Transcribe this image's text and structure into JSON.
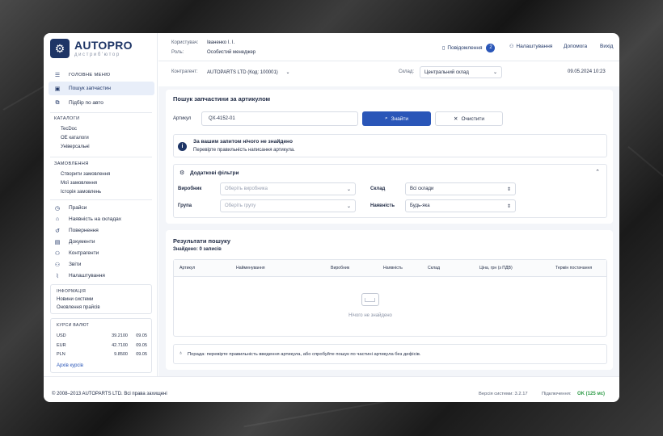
{
  "brand": {
    "name": "AUTOPRO",
    "tagline": "дистриб'ютор",
    "logo_icon": "gear-icon"
  },
  "sidebar": {
    "main_menu_label": "ГОЛОВНЕ МЕНЮ",
    "nav": [
      {
        "label": "Пошук запчастин",
        "icon": "toolbox-icon"
      },
      {
        "label": "Підбір по авто",
        "icon": "car-icon"
      }
    ],
    "catalogs_title": "КАТАЛОГИ",
    "catalogs": [
      "TecDoc",
      "OE каталоги",
      "Універсальні"
    ],
    "orders_title": "ЗАМОВЛЕННЯ",
    "orders": [
      "Створити замовлення",
      "Мої замовлення",
      "Історія замовлень"
    ],
    "menu": [
      {
        "label": "Прайси",
        "icon": "clock-icon"
      },
      {
        "label": "Наявність на складах",
        "icon": "warehouse-icon"
      },
      {
        "label": "Повернення",
        "icon": "return-icon"
      },
      {
        "label": "Документи",
        "icon": "document-icon"
      },
      {
        "label": "Контрагенти",
        "icon": "users-icon"
      },
      {
        "label": "Звіти",
        "icon": "report-icon"
      },
      {
        "label": "Налаштування",
        "icon": "chart-icon"
      }
    ],
    "info": {
      "title": "ІНФОРМАЦІЯ",
      "items": [
        "Новини системи",
        "Оновлення прайсів"
      ]
    },
    "rates": {
      "title": "КУРСИ ВАЛЮТ",
      "rows": [
        {
          "code": "USD",
          "value": "39.2100",
          "date": "09.05"
        },
        {
          "code": "EUR",
          "value": "42.7100",
          "date": "09.05"
        },
        {
          "code": "PLN",
          "value": "9.8500",
          "date": "09.05"
        }
      ],
      "archive": "Архів курсів"
    }
  },
  "header": {
    "user_label": "Користувач:",
    "user_value": "Іваненко І. І.",
    "role_label": "Роль:",
    "role_value": "Особистий менеджер",
    "notifications": "Повідомлення",
    "notifications_count": "2",
    "settings": "Налаштування",
    "help": "Допомога",
    "logout": "Вихід",
    "counterparty_label": "Контрагент:",
    "counterparty_value": "AUTOPARTS LTD (Код: 100001)",
    "warehouse_label": "Склад:",
    "warehouse_value": "Центральний склад",
    "datetime": "09.05.2024 10:23"
  },
  "search": {
    "title": "Пошук запчастини за артикулом",
    "article_label": "Артикул",
    "article_value": "QX-4152-01",
    "find_button": "Знайти",
    "clear_button": "Очистити"
  },
  "alert": {
    "title": "За вашим запитом нічого не знайдено",
    "text": "Перевірте правильність написання артикула."
  },
  "filters": {
    "title": "Додаткові фільтри",
    "manufacturer_label": "Виробник",
    "manufacturer_placeholder": "Оберіть виробника",
    "warehouse_label": "Склад",
    "warehouse_value": "Всі склади",
    "group_label": "Група",
    "group_placeholder": "Оберіть групу",
    "availability_label": "Наявність",
    "availability_value": "Будь-яка"
  },
  "results": {
    "title": "Результати пошуку",
    "found": "Знайдено: 0 записів",
    "columns": [
      "Артикул",
      "Найменування",
      "Виробник",
      "Наявність",
      "Склад",
      "Ціна, грн (з ПДВ)",
      "Термін постачання"
    ],
    "empty": "Нічого не знайдено"
  },
  "tip": "Порада: перевірте правильність введення артикула, або спробуйте пошук по частині артикула без дефісів.",
  "footer": {
    "copyright": "© 2008–2013 AUTOPARTS LTD. Всі права захищені",
    "version": "Версія системи: 3.2.17",
    "connection_label": "Підключення:",
    "connection_value": "OK (125 мс)"
  },
  "colors": {
    "accent": "#2a56b8",
    "brand": "#1e3566",
    "ok": "#2e9b47"
  }
}
